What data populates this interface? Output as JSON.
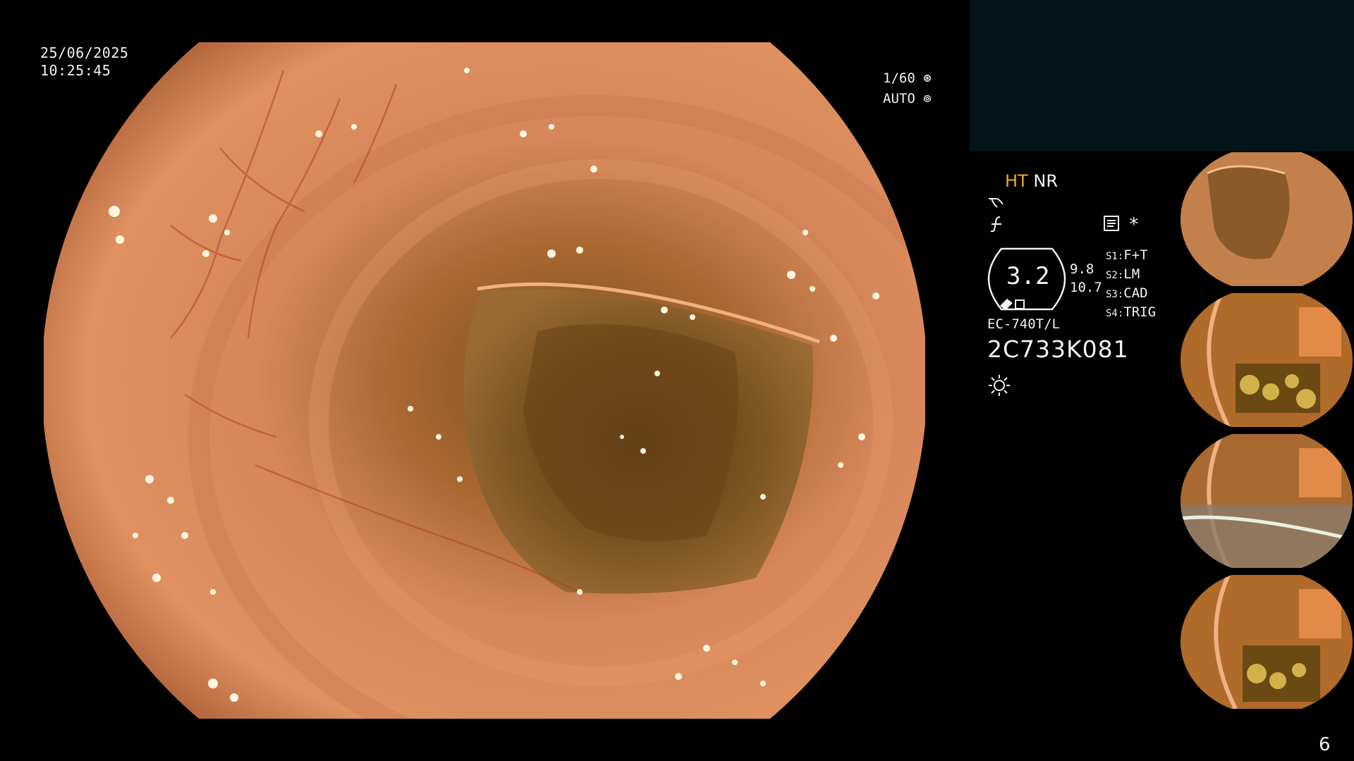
{
  "overlay": {
    "date": "25/06/2025",
    "time": "10:25:45",
    "shutter": "1/60",
    "exposure_mode": "AUTO"
  },
  "status_panel": {
    "mode_ht": "HT",
    "mode_nr": "NR",
    "zoom_value": "3.2",
    "zoom_side_top": "9.8",
    "zoom_side_bottom": "10.7",
    "switches": [
      {
        "key": "S1:",
        "value": "F+T"
      },
      {
        "key": "S2:",
        "value": "LM"
      },
      {
        "key": "S3:",
        "value": "CAD"
      },
      {
        "key": "S4:",
        "value": "TRIG"
      }
    ],
    "asterisk": "*",
    "scope_model": "EC-740T/L",
    "serial": "2C733K081"
  },
  "thumbnails_count": 4,
  "page_number": "6",
  "colors": {
    "ht_accent": "#f5a623",
    "top_panel_bg": "#02161a",
    "mucosa": "#d98a5a"
  },
  "icons": [
    "shutter-icon",
    "auto-iris-icon",
    "tone-icon",
    "enhance-icon",
    "memo-icon",
    "light-icon"
  ]
}
